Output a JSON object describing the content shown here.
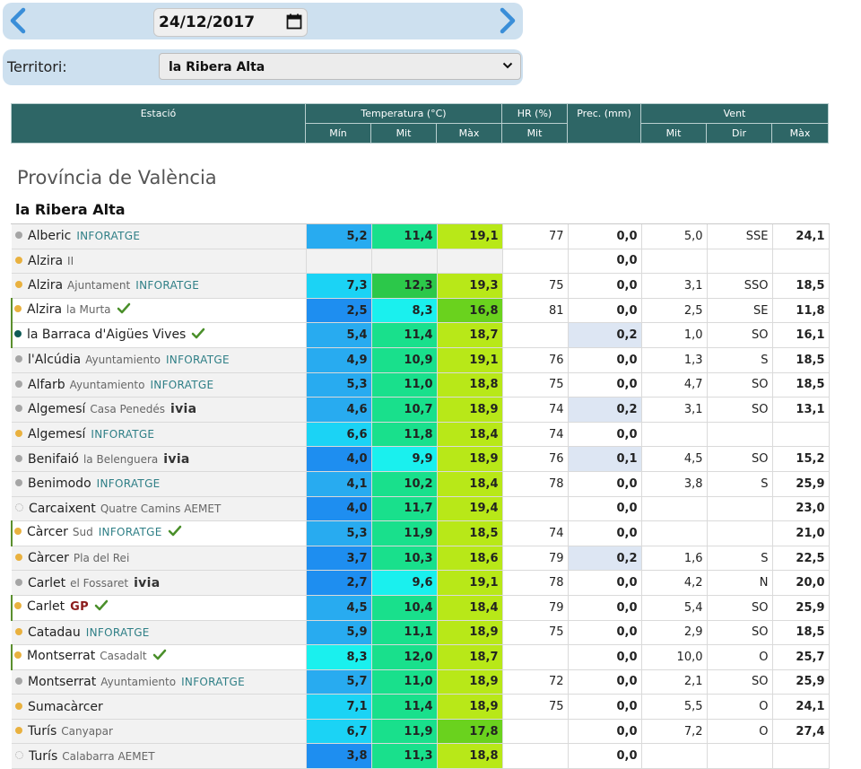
{
  "date": {
    "value": "24/12/2017"
  },
  "territory": {
    "label": "Territori:",
    "selected": "la Ribera Alta"
  },
  "header": {
    "station": "Estació",
    "temperature": "Temperatura (°C)",
    "hr": "HR (%)",
    "prec": "Prec. (mm)",
    "wind": "Vent",
    "min": "Mín",
    "mit": "Mit",
    "max": "Màx",
    "hr_mit": "Mit",
    "w_mit": "Mit",
    "dir": "Dir",
    "w_max": "Màx"
  },
  "province": "Província de València",
  "region": "la Ribera Alta",
  "colors": {
    "dot_gray": "#a5a5a5",
    "dot_orange": "#e9b13f",
    "dot_teal": "#0e5a55",
    "inforatge_a": "#e0883c",
    "inforatge_b": "#2f7f86",
    "ivia_a": "#333333",
    "ivia_b": "#e0883c",
    "gp": "#8b1a1a",
    "check": "#4a8f2a",
    "prec_hl": "#dde6f3"
  },
  "stations": [
    {
      "name": "Alberic",
      "sub": "",
      "source": "INFORATGE",
      "dot": "gray",
      "check": false,
      "hl": false,
      "min": "5,2",
      "mit": "11,4",
      "max": "19,1",
      "hr": "77",
      "prec": "0,0",
      "phl": false,
      "wmit": "5,0",
      "dir": "SSE",
      "wmax": "24,1",
      "cmin": "#28abf0",
      "cmit": "#19e08c",
      "cmax": "#b8e818"
    },
    {
      "name": "Alzira",
      "sub": "II",
      "source": "",
      "dot": "orange",
      "check": false,
      "hl": false,
      "min": "",
      "mit": "",
      "max": "",
      "hr": "",
      "prec": "0,0",
      "phl": false,
      "wmit": "",
      "dir": "",
      "wmax": "",
      "cmin": "#f2f2f2",
      "cmit": "#f2f2f2",
      "cmax": "#f2f2f2"
    },
    {
      "name": "Alzira",
      "sub": "Ajuntament",
      "source": "INFORATGE",
      "dot": "orange",
      "check": false,
      "hl": false,
      "min": "7,3",
      "mit": "12,3",
      "max": "19,3",
      "hr": "75",
      "prec": "0,0",
      "phl": false,
      "wmit": "3,1",
      "dir": "SSO",
      "wmax": "18,5",
      "cmin": "#1bd3f5",
      "cmit": "#2cc84a",
      "cmax": "#b8e818"
    },
    {
      "name": "Alzira",
      "sub": "la Murta",
      "source": "",
      "dot": "orange",
      "check": true,
      "hl": true,
      "min": "2,5",
      "mit": "8,3",
      "max": "16,8",
      "hr": "81",
      "prec": "0,0",
      "phl": false,
      "wmit": "2,5",
      "dir": "SE",
      "wmax": "11,8",
      "cmin": "#1e8ef0",
      "cmit": "#1af0ee",
      "cmax": "#6ad21e"
    },
    {
      "name": "la Barraca d'Aigües Vives",
      "sub": "",
      "source": "",
      "dot": "teal",
      "check": true,
      "hl": true,
      "min": "5,4",
      "mit": "11,4",
      "max": "18,7",
      "hr": "",
      "prec": "0,2",
      "phl": true,
      "wmit": "1,0",
      "dir": "SO",
      "wmax": "16,1",
      "cmin": "#28abf0",
      "cmit": "#19e08c",
      "cmax": "#b8e818"
    },
    {
      "name": "l'Alcúdia",
      "sub": "Ayuntamiento",
      "source": "INFORATGE",
      "dot": "gray",
      "check": false,
      "hl": false,
      "min": "4,9",
      "mit": "10,9",
      "max": "19,1",
      "hr": "76",
      "prec": "0,0",
      "phl": false,
      "wmit": "1,3",
      "dir": "S",
      "wmax": "18,5",
      "cmin": "#28abf0",
      "cmit": "#19e08c",
      "cmax": "#b8e818"
    },
    {
      "name": "Alfarb",
      "sub": "Ayuntamiento",
      "source": "INFORATGE",
      "dot": "gray",
      "check": false,
      "hl": false,
      "min": "5,3",
      "mit": "11,0",
      "max": "18,8",
      "hr": "75",
      "prec": "0,0",
      "phl": false,
      "wmit": "4,7",
      "dir": "SO",
      "wmax": "18,5",
      "cmin": "#28abf0",
      "cmit": "#19e08c",
      "cmax": "#b8e818"
    },
    {
      "name": "Algemesí",
      "sub": "Casa Penedés",
      "source": "ivia",
      "dot": "gray",
      "check": false,
      "hl": false,
      "min": "4,6",
      "mit": "10,7",
      "max": "18,9",
      "hr": "74",
      "prec": "0,2",
      "phl": true,
      "wmit": "3,1",
      "dir": "SO",
      "wmax": "13,1",
      "cmin": "#28abf0",
      "cmit": "#19e08c",
      "cmax": "#b8e818"
    },
    {
      "name": "Algemesí",
      "sub": "",
      "source": "INFORATGE",
      "dot": "orange",
      "check": false,
      "hl": false,
      "min": "6,6",
      "mit": "11,8",
      "max": "18,4",
      "hr": "74",
      "prec": "0,0",
      "phl": false,
      "wmit": "",
      "dir": "",
      "wmax": "",
      "cmin": "#1bd3f5",
      "cmit": "#19e08c",
      "cmax": "#b8e818"
    },
    {
      "name": "Benifaió",
      "sub": "la Belenguera",
      "source": "ivia",
      "dot": "gray",
      "check": false,
      "hl": false,
      "min": "4,0",
      "mit": "9,9",
      "max": "18,9",
      "hr": "76",
      "prec": "0,1",
      "phl": true,
      "wmit": "4,5",
      "dir": "SO",
      "wmax": "15,2",
      "cmin": "#1e8ef0",
      "cmit": "#1af0ee",
      "cmax": "#b8e818"
    },
    {
      "name": "Benimodo",
      "sub": "",
      "source": "INFORATGE",
      "dot": "gray",
      "check": false,
      "hl": false,
      "min": "4,1",
      "mit": "10,2",
      "max": "18,4",
      "hr": "78",
      "prec": "0,0",
      "phl": false,
      "wmit": "3,8",
      "dir": "S",
      "wmax": "25,9",
      "cmin": "#28abf0",
      "cmit": "#19e08c",
      "cmax": "#b8e818"
    },
    {
      "name": "Carcaixent",
      "sub": "Quatre Camins AEMET",
      "source": "",
      "dot": "dotted",
      "check": false,
      "hl": false,
      "min": "4,0",
      "mit": "11,7",
      "max": "19,4",
      "hr": "",
      "prec": "0,0",
      "phl": false,
      "wmit": "",
      "dir": "",
      "wmax": "23,0",
      "cmin": "#1e8ef0",
      "cmit": "#19e08c",
      "cmax": "#b8e818"
    },
    {
      "name": "Càrcer",
      "sub": "Sud",
      "source": "INFORATGE",
      "dot": "orange",
      "check": true,
      "hl": true,
      "min": "5,3",
      "mit": "11,9",
      "max": "18,5",
      "hr": "74",
      "prec": "0,0",
      "phl": false,
      "wmit": "",
      "dir": "",
      "wmax": "21,0",
      "cmin": "#28abf0",
      "cmit": "#19e08c",
      "cmax": "#b8e818"
    },
    {
      "name": "Càrcer",
      "sub": "Pla del Rei",
      "source": "",
      "dot": "orange",
      "check": false,
      "hl": false,
      "min": "3,7",
      "mit": "10,3",
      "max": "18,6",
      "hr": "79",
      "prec": "0,2",
      "phl": true,
      "wmit": "1,6",
      "dir": "S",
      "wmax": "22,5",
      "cmin": "#1e8ef0",
      "cmit": "#19e08c",
      "cmax": "#b8e818"
    },
    {
      "name": "Carlet",
      "sub": "el Fossaret",
      "source": "ivia",
      "dot": "gray",
      "check": false,
      "hl": false,
      "min": "2,7",
      "mit": "9,6",
      "max": "19,1",
      "hr": "78",
      "prec": "0,0",
      "phl": false,
      "wmit": "4,2",
      "dir": "N",
      "wmax": "20,0",
      "cmin": "#1e8ef0",
      "cmit": "#1af0ee",
      "cmax": "#b8e818"
    },
    {
      "name": "Carlet",
      "sub": "",
      "source": "GP",
      "dot": "orange",
      "check": true,
      "hl": true,
      "min": "4,5",
      "mit": "10,4",
      "max": "18,4",
      "hr": "79",
      "prec": "0,0",
      "phl": false,
      "wmit": "5,4",
      "dir": "SO",
      "wmax": "25,9",
      "cmin": "#28abf0",
      "cmit": "#19e08c",
      "cmax": "#b8e818"
    },
    {
      "name": "Catadau",
      "sub": "",
      "source": "INFORATGE",
      "dot": "orange",
      "check": false,
      "hl": false,
      "min": "5,9",
      "mit": "11,1",
      "max": "18,9",
      "hr": "75",
      "prec": "0,0",
      "phl": false,
      "wmit": "2,9",
      "dir": "SO",
      "wmax": "18,5",
      "cmin": "#28abf0",
      "cmit": "#19e08c",
      "cmax": "#b8e818"
    },
    {
      "name": "Montserrat",
      "sub": "Casadalt",
      "source": "",
      "dot": "orange",
      "check": true,
      "hl": true,
      "min": "8,3",
      "mit": "12,0",
      "max": "18,7",
      "hr": "",
      "prec": "0,0",
      "phl": false,
      "wmit": "10,0",
      "dir": "O",
      "wmax": "25,7",
      "cmin": "#1af0ee",
      "cmit": "#19e08c",
      "cmax": "#b8e818"
    },
    {
      "name": "Montserrat",
      "sub": "Ayuntamiento",
      "source": "INFORATGE",
      "dot": "gray",
      "check": false,
      "hl": false,
      "min": "5,7",
      "mit": "11,0",
      "max": "18,9",
      "hr": "72",
      "prec": "0,0",
      "phl": false,
      "wmit": "2,1",
      "dir": "SO",
      "wmax": "25,9",
      "cmin": "#28abf0",
      "cmit": "#19e08c",
      "cmax": "#b8e818"
    },
    {
      "name": "Sumacàrcer",
      "sub": "",
      "source": "",
      "dot": "orange",
      "check": false,
      "hl": false,
      "min": "7,1",
      "mit": "11,4",
      "max": "18,9",
      "hr": "75",
      "prec": "0,0",
      "phl": false,
      "wmit": "5,5",
      "dir": "O",
      "wmax": "24,1",
      "cmin": "#1bd3f5",
      "cmit": "#19e08c",
      "cmax": "#b8e818"
    },
    {
      "name": "Turís",
      "sub": "Canyapar",
      "source": "",
      "dot": "orange",
      "check": false,
      "hl": false,
      "min": "6,7",
      "mit": "11,9",
      "max": "17,8",
      "hr": "",
      "prec": "0,0",
      "phl": false,
      "wmit": "7,2",
      "dir": "O",
      "wmax": "27,4",
      "cmin": "#1bd3f5",
      "cmit": "#19e08c",
      "cmax": "#6ad21e"
    },
    {
      "name": "Turís",
      "sub": "Calabarra AEMET",
      "source": "",
      "dot": "dotted",
      "check": false,
      "hl": false,
      "min": "3,8",
      "mit": "11,3",
      "max": "18,8",
      "hr": "",
      "prec": "0,0",
      "phl": false,
      "wmit": "",
      "dir": "",
      "wmax": "",
      "cmin": "#1e8ef0",
      "cmit": "#19e08c",
      "cmax": "#b8e818"
    }
  ]
}
